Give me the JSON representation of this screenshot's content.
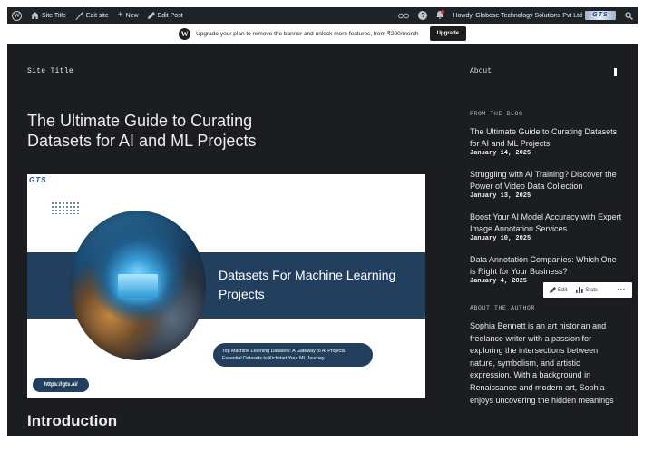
{
  "adminbar": {
    "site_title": "Site Title",
    "edit_site": "Edit site",
    "new": "New",
    "edit_post": "Edit Post",
    "howdy": "Howdy, Globose Technology Solutions Pvt Ltd",
    "avatar_text": "GTS"
  },
  "banner": {
    "message": "Upgrade your plan to remove the banner and unlock more features, from ₹200/month",
    "upgrade_label": "Upgrade"
  },
  "site": {
    "title": "Site Title",
    "nav_about": "About"
  },
  "post": {
    "title": "The Ultimate Guide to Curating Datasets for AI and ML Projects",
    "image": {
      "logo": "GTS",
      "headline": "Datasets For Machine Learning Projects",
      "pill_line1": "Top Machine Learning Datasets: A Gateway to AI Projects.",
      "pill_line2": "Essential Datasets to Kickstart Your ML Journey.",
      "url": "https://gts.ai/"
    },
    "intro_heading": "Introduction"
  },
  "sidebar": {
    "blog_title": "FROM THE BLOG",
    "posts": [
      {
        "title": "The Ultimate Guide to Curating Datasets for AI and ML Projects",
        "date": "January 14, 2025"
      },
      {
        "title": "Struggling with AI Training? Discover the Power of Video Data Collection",
        "date": "January 13, 2025"
      },
      {
        "title": "Boost Your AI Model Accuracy with Expert Image Annotation Services",
        "date": "January 10, 2025"
      },
      {
        "title": "Data Annotation Companies: Which One is Right for Your Business?",
        "date": "January 4, 2025"
      }
    ],
    "about_title": "ABOUT THE AUTHOR",
    "about_text": "Sophia Bennett is an art historian and freelance writer with a passion for exploring the intersections between nature, symbolism, and artistic expression. With a background in Renaissance and modern art, Sophia enjoys uncovering the hidden meanings"
  },
  "hover_toolbar": {
    "edit": "Edit",
    "stats": "Stats",
    "more": "•••"
  },
  "icons": [
    "wordpress-icon",
    "home-icon",
    "brush-icon",
    "plus-icon",
    "pencil-icon",
    "reader-icon",
    "help-icon",
    "bell-icon",
    "search-icon",
    "stats-icon"
  ]
}
